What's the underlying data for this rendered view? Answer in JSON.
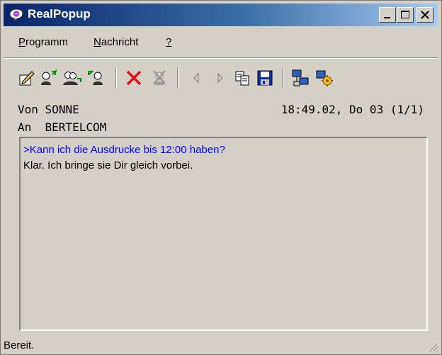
{
  "window": {
    "title": "RealPopup",
    "buttons": [
      "minimize",
      "maximize",
      "close"
    ]
  },
  "menubar": {
    "items": [
      {
        "label": "Programm",
        "mnemonic": "P"
      },
      {
        "label": "Nachricht",
        "mnemonic": "N"
      },
      {
        "label": "?",
        "mnemonic": "?"
      }
    ]
  },
  "toolbar": {
    "icons": [
      "new-message-icon",
      "reply-icon",
      "reply-all-icon",
      "forward-icon",
      "delete-icon",
      "delete-all-icon",
      "previous-icon",
      "next-icon",
      "copy-icon",
      "save-icon",
      "network-icon",
      "settings-icon"
    ]
  },
  "header": {
    "from_label": "Von",
    "from_value": "SONNE",
    "timestamp": "18:49.02, Do 03 (1/1)",
    "to_label": "An",
    "to_value": "BERTELCOM"
  },
  "message": {
    "quote": ">Kann ich die Ausdrucke bis 12:00 haben?",
    "body": "Klar. Ich bringe sie Dir gleich vorbei."
  },
  "status": {
    "text": "Bereit."
  },
  "colors": {
    "titlebar_start": "#0a246a",
    "titlebar_end": "#a6caf0",
    "quote_text": "#0000ff",
    "window_bg": "#d4d0c8"
  }
}
